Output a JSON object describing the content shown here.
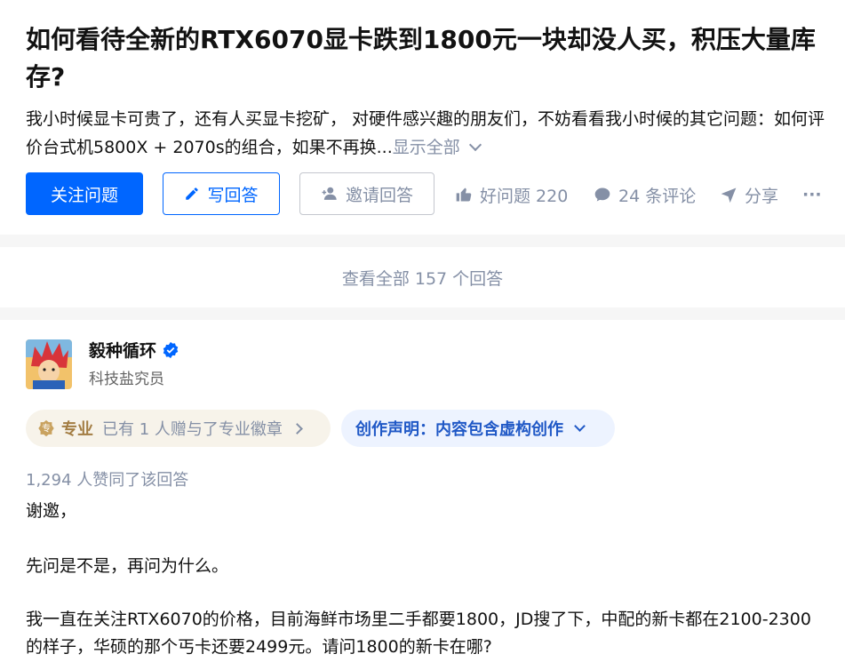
{
  "question": {
    "title": "如何看待全新的RTX6070显卡跌到1800元一块却没人买，积压大量库存?",
    "excerpt": "我小时候显卡可贵了，还有人买显卡挖矿， 对硬件感兴趣的朋友们，不妨看看我小时候的其它问题：如何评价台式机5800X + 2070s的组合，如果不再换...",
    "show_all": "显示全部",
    "buttons": {
      "follow": "关注问题",
      "write": "写回答",
      "invite": "邀请回答"
    },
    "actions": {
      "good_question": "好问题 220",
      "comments": "24 条评论",
      "share": "分享",
      "more": "···"
    }
  },
  "view_all_answers": "查看全部 157 个回答",
  "answer": {
    "author_name": "毅种循环",
    "author_bio": "科技盐究员",
    "badge": {
      "label": "专业",
      "text": "已有 1 人赠与了专业徽章"
    },
    "declaration": "创作声明：内容包含虚构创作",
    "upvotes": "1,294 人赞同了该回答",
    "paragraphs": [
      "谢邀，",
      "先问是不是，再问为什么。",
      "我一直在关注RTX6070的价格，目前海鲜市场里二手都要1800，JD搜了下，中配的新卡都在2100-2300的样子，华硕的那个丐卡还要2499元。请问1800的新卡在哪?"
    ]
  },
  "colors": {
    "primary": "#0066ff",
    "muted": "#8590a6",
    "badge_bg": "#f7f3ea",
    "badge_text": "#a37d43",
    "declaration_bg": "#edf3ff",
    "declaration_text": "#1f58c6",
    "verified": "#0066ff"
  },
  "icons": [
    "pen-icon",
    "invite-user-icon",
    "thumbs-up-icon",
    "comment-icon",
    "share-icon",
    "more-icon",
    "verified-icon",
    "badge-icon",
    "chevron-down-icon",
    "chevron-right-icon"
  ]
}
